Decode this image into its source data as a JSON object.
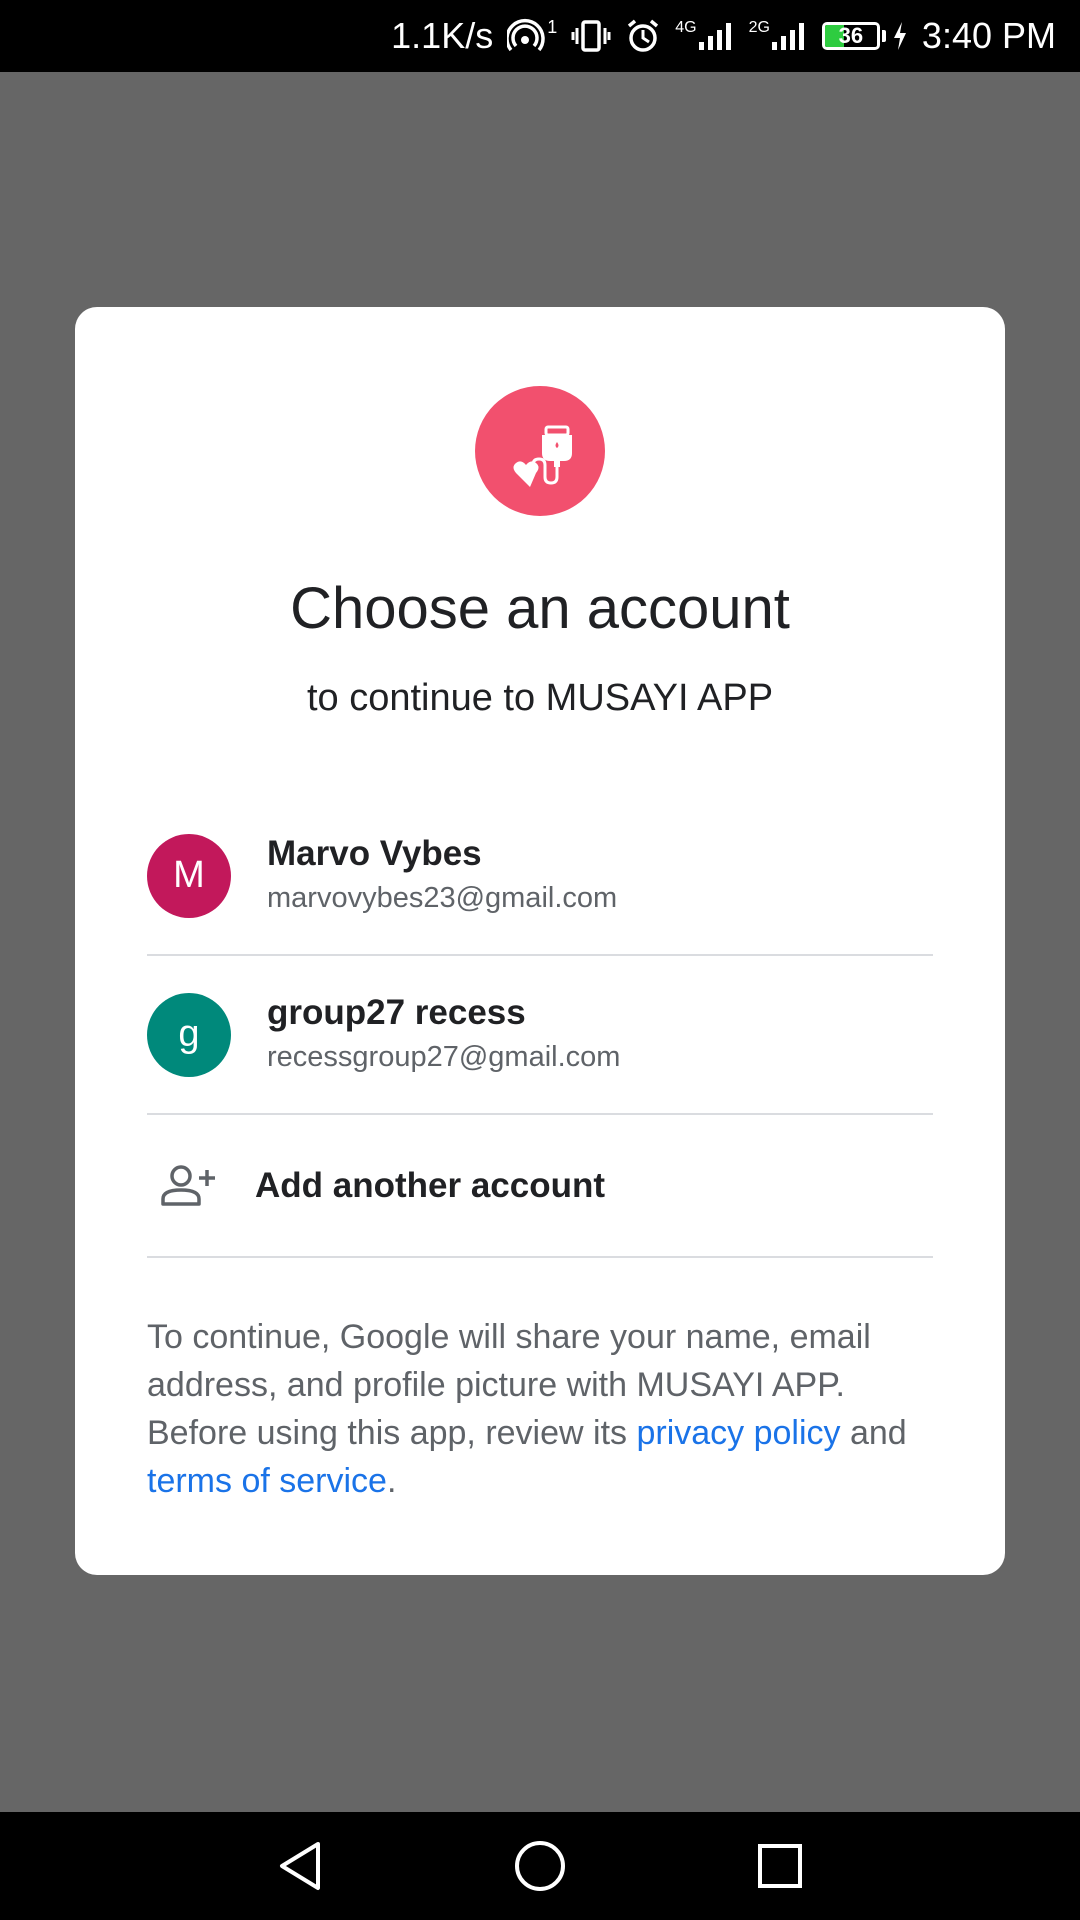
{
  "status_bar": {
    "net_speed": "1.1K/s",
    "hotspot_badge": "1",
    "network_4g": "4G",
    "network_2g": "2G",
    "battery_level": "36",
    "battery_fraction": 0.36,
    "time": "3:40 PM",
    "icons": [
      "hotspot-icon",
      "vibrate-icon",
      "alarm-icon",
      "signal-4g-icon",
      "signal-2g-icon",
      "battery-icon",
      "charging-icon"
    ]
  },
  "dialog": {
    "logo_icon": "iv-drip-heart-icon",
    "logo_color": "#f2506e",
    "title": "Choose an account",
    "subtitle": "to continue to MUSAYI APP",
    "accounts": [
      {
        "initial": "M",
        "name": "Marvo Vybes",
        "email": "marvovybes23@gmail.com",
        "color": "#c2185b"
      },
      {
        "initial": "g",
        "name": "group27 recess",
        "email": "recessgroup27@gmail.com",
        "color": "#00897b"
      }
    ],
    "add_account": {
      "icon": "add-person-icon",
      "label": "Add another account"
    },
    "disclaimer": {
      "part1": "To continue, Google will share your name, email address, and profile picture with MUSAYI APP. Before using this app, review its ",
      "privacy_link": "privacy policy",
      "part2": " and ",
      "terms_link": "terms of service",
      "part3": "."
    }
  },
  "nav_bar": {
    "back": "back-icon",
    "home": "home-icon",
    "recents": "recents-icon"
  },
  "colors": {
    "scrim": "#666666",
    "link": "#1a73e8"
  }
}
